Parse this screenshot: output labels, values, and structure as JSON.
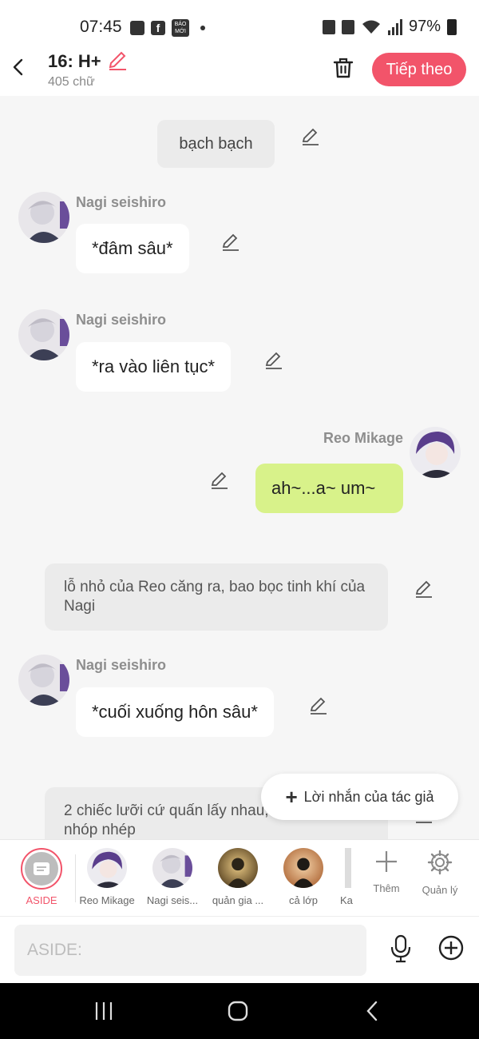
{
  "status_bar": {
    "time": "07:45",
    "battery": "97%",
    "news_icon_text": "BÁO MỚI"
  },
  "header": {
    "title": "16: H+",
    "word_count": "405 chữ",
    "next_label": "Tiếp theo"
  },
  "messages": [
    {
      "type": "narration",
      "text": "bạch bạch"
    },
    {
      "type": "left",
      "name": "Nagi seishiro",
      "text": "*đâm sâu*"
    },
    {
      "type": "left",
      "name": "Nagi seishiro",
      "text": "*ra vào liên tục*"
    },
    {
      "type": "right",
      "name": "Reo Mikage",
      "text": "ah~...a~ um~"
    },
    {
      "type": "narration",
      "text": "lỗ nhỏ của Reo căng ra, bao bọc tinh khí của Nagi"
    },
    {
      "type": "left",
      "name": "Nagi seishiro",
      "text": "*cuối xuống hôn sâu*"
    },
    {
      "type": "narration",
      "text": "2 chiếc lưỡi cứ quấn lấy nhau, tạo ra tiếng nhóp nhép"
    }
  ],
  "author_note_label": "Lời nhắn của tác giả",
  "characters": [
    {
      "label": "ASIDE"
    },
    {
      "label": "Reo Mikage"
    },
    {
      "label": "Nagi seis..."
    },
    {
      "label": "quản gia ..."
    },
    {
      "label": "cả lớp"
    },
    {
      "label": "Ka"
    }
  ],
  "tools": {
    "add_label": "Thêm",
    "manage_label": "Quản lý"
  },
  "input": {
    "placeholder": "ASIDE:"
  },
  "colors": {
    "accent": "#f2546a",
    "green_bubble": "#d8f28a",
    "narration_bg": "#ebebeb"
  }
}
